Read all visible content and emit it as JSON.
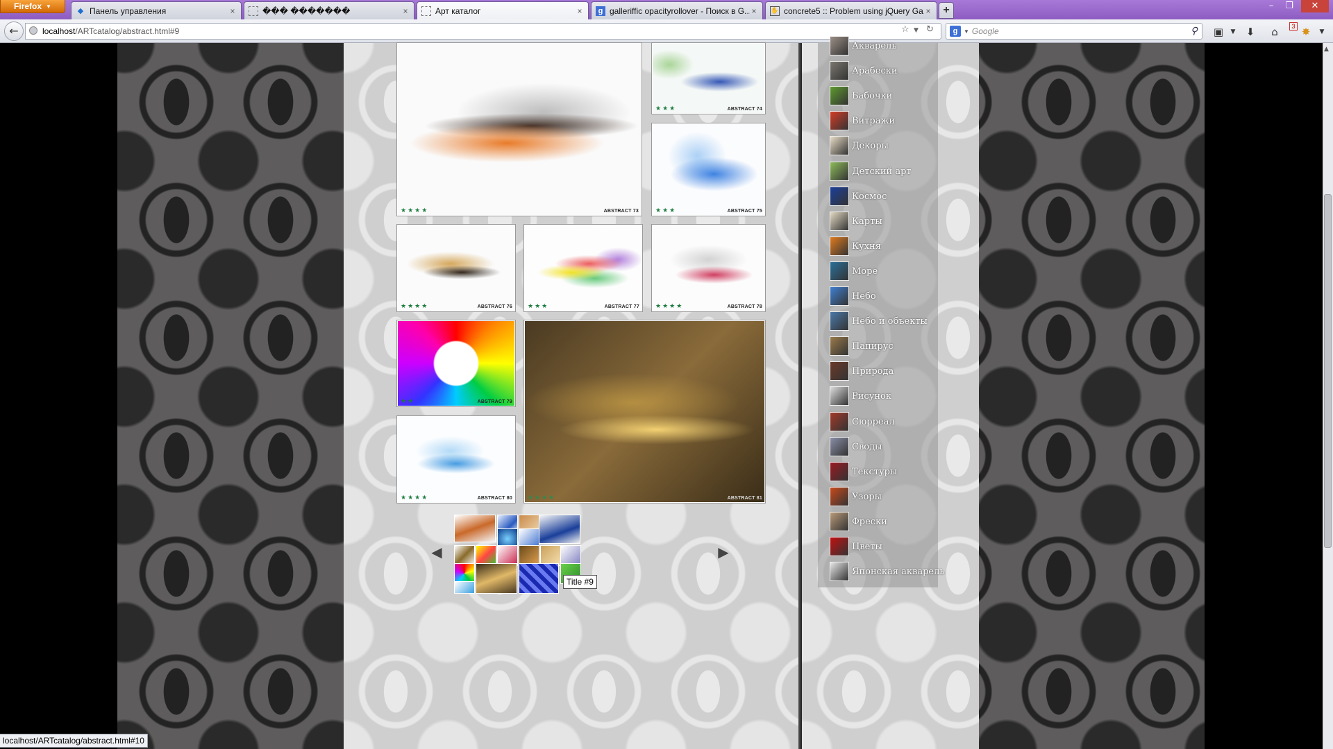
{
  "browser": {
    "menu_button": "Firefox",
    "tabs": [
      {
        "title": "Панель управления",
        "icon": "blue-diamond-icon",
        "active": false
      },
      {
        "title": "��� �������",
        "icon": "blank-page-icon",
        "active": false
      },
      {
        "title": "Арт каталог",
        "icon": "blank-page-icon",
        "active": true
      },
      {
        "title": "galleriffic opacityrollover - Поиск в G...",
        "icon": "google-icon",
        "active": false
      },
      {
        "title": "concrete5 :: Problem using jQuery Ga...",
        "icon": "concrete5-hand-icon",
        "active": false
      }
    ],
    "new_tab": "+",
    "url_host": "localhost",
    "url_path": "/ARTcatalog/abstract.html#9",
    "search_placeholder": "Google",
    "search_engine_letter": "g",
    "addon_badge": "3",
    "status_url": "localhost/ARTcatalog/abstract.html#10"
  },
  "gallery": {
    "thumbs": [
      {
        "id": "t73",
        "caption": "ABSTRACT 73",
        "stars": "★★★★"
      },
      {
        "id": "t74",
        "caption": "ABSTRACT 74",
        "stars": "★★★"
      },
      {
        "id": "t75",
        "caption": "ABSTRACT 75",
        "stars": "★★★"
      },
      {
        "id": "t76",
        "caption": "ABSTRACT 76",
        "stars": "★★★★"
      },
      {
        "id": "t77",
        "caption": "ABSTRACT 77",
        "stars": "★★★"
      },
      {
        "id": "t78",
        "caption": "ABSTRACT 78",
        "stars": "★★★★"
      },
      {
        "id": "t79",
        "caption": "ABSTRACT 79",
        "stars": "★★"
      },
      {
        "id": "t80",
        "caption": "ABSTRACT 80",
        "stars": "★★★★"
      },
      {
        "id": "t81",
        "caption": "ABSTRACT 81",
        "stars": "★★★★"
      }
    ],
    "prev_arrow": "◀",
    "next_arrow": "▶",
    "tooltip": "Title #9"
  },
  "categories": [
    {
      "label": "Акварель",
      "color": "#9c8f86"
    },
    {
      "label": "Арабески",
      "color": "#7a776e"
    },
    {
      "label": "Бабочки",
      "color": "#5e9b2e"
    },
    {
      "label": "Витражи",
      "color": "#d43c26"
    },
    {
      "label": "Декоры",
      "color": "#e8dcc6"
    },
    {
      "label": "Детский арт",
      "color": "#8dbb5a"
    },
    {
      "label": "Космос",
      "color": "#1b3f9a"
    },
    {
      "label": "Карты",
      "color": "#e2d8c2"
    },
    {
      "label": "Кухня",
      "color": "#e07a1e"
    },
    {
      "label": "Море",
      "color": "#2a6f9a"
    },
    {
      "label": "Небо",
      "color": "#3f7fd0"
    },
    {
      "label": "Небо и объекты",
      "color": "#4a78a8"
    },
    {
      "label": "Папирус",
      "color": "#9a7a4a"
    },
    {
      "label": "Природа",
      "color": "#6a3a2a"
    },
    {
      "label": "Рисунок",
      "color": "#dcdcdc"
    },
    {
      "label": "Сюрреал",
      "color": "#a23a2a"
    },
    {
      "label": "Своды",
      "color": "#8a8fa8"
    },
    {
      "label": "Текстуры",
      "color": "#9a1a22"
    },
    {
      "label": "Узоры",
      "color": "#c84a1a"
    },
    {
      "label": "Фрески",
      "color": "#b89a78"
    },
    {
      "label": "Цветы",
      "color": "#c21010"
    },
    {
      "label": "Японская акварель",
      "color": "#e6e6e6"
    }
  ]
}
